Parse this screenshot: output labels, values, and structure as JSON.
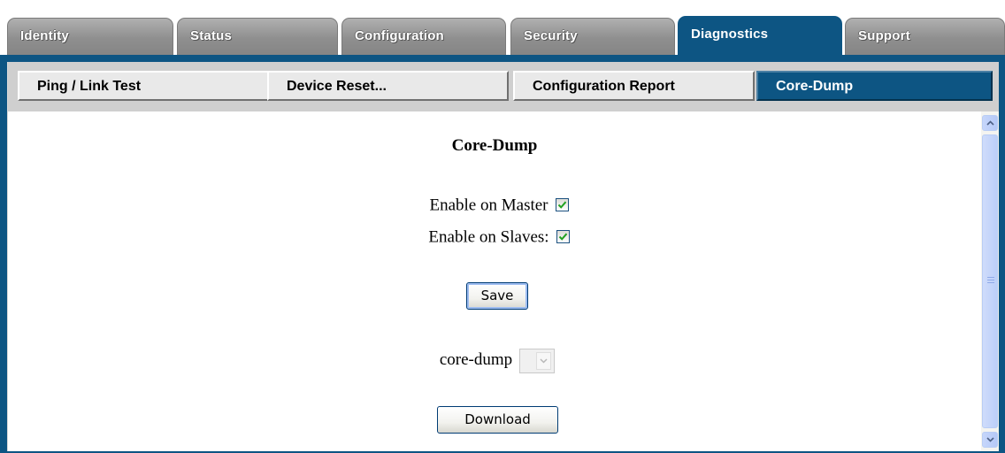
{
  "tabs": [
    {
      "label": "Identity"
    },
    {
      "label": "Status"
    },
    {
      "label": "Configuration"
    },
    {
      "label": "Security"
    },
    {
      "label": "Diagnostics"
    },
    {
      "label": "Support"
    }
  ],
  "active_tab": "Diagnostics",
  "subtabs": [
    {
      "label": "Ping / Link Test"
    },
    {
      "label": "Device Reset..."
    },
    {
      "label": "Configuration Report"
    },
    {
      "label": "Core-Dump"
    }
  ],
  "active_subtab": "Core-Dump",
  "content": {
    "heading": "Core-Dump",
    "enable_master_label": "Enable on Master",
    "enable_master_checked": true,
    "enable_slaves_label": "Enable on Slaves:",
    "enable_slaves_checked": true,
    "save_label": "Save",
    "select_label": "core-dump",
    "select_value": "",
    "download_label": "Download"
  },
  "colors": {
    "accent": "#0d5583",
    "tab_inactive": "#8f8f8f",
    "subbar": "#cfcfcf",
    "scrollbar": "#c6d6fb"
  },
  "icons": {
    "checkbox_check": "check-icon",
    "select_arrow": "chevron-down-icon",
    "scroll_up": "chevron-up-icon",
    "scroll_down": "chevron-down-icon"
  }
}
